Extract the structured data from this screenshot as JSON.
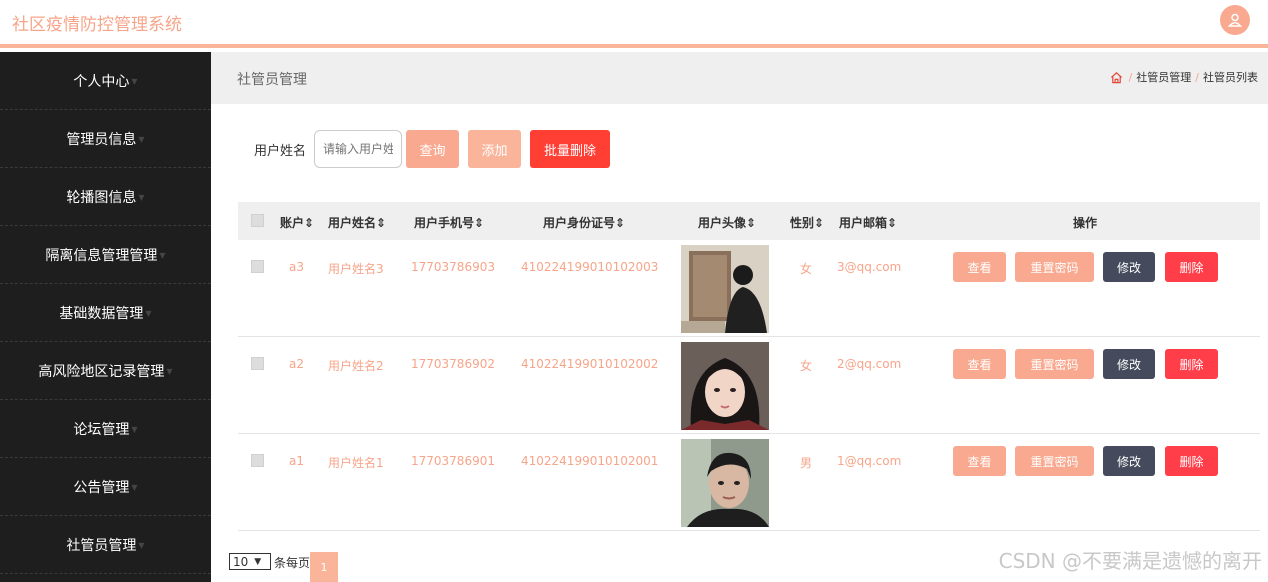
{
  "app_title": "社区疫情防控管理系统",
  "sidebar": {
    "items": [
      {
        "label": "个人中心"
      },
      {
        "label": "管理员信息"
      },
      {
        "label": "轮播图信息"
      },
      {
        "label": "隔离信息管理管理"
      },
      {
        "label": "基础数据管理"
      },
      {
        "label": "高风险地区记录管理"
      },
      {
        "label": "论坛管理"
      },
      {
        "label": "公告管理"
      },
      {
        "label": "社管员管理"
      }
    ]
  },
  "page_header": {
    "title": "社管员管理",
    "breadcrumb": [
      "社管员管理",
      "社管员列表"
    ]
  },
  "search": {
    "label": "用户姓名",
    "placeholder": "请输入用户姓",
    "query_label": "查询",
    "add_label": "添加",
    "batch_delete_label": "批量删除"
  },
  "table": {
    "headers": {
      "account": "账户",
      "name": "用户姓名",
      "phone": "用户手机号",
      "id_card": "用户身份证号",
      "avatar": "用户头像",
      "gender": "性别",
      "email": "用户邮箱",
      "actions": "操作"
    },
    "rows": [
      {
        "account": "a3",
        "name": "用户姓名3",
        "phone": "17703786903",
        "id_card": "410224199010102003",
        "gender": "女",
        "email": "3@qq.com"
      },
      {
        "account": "a2",
        "name": "用户姓名2",
        "phone": "17703786902",
        "id_card": "410224199010102002",
        "gender": "女",
        "email": "2@qq.com"
      },
      {
        "account": "a1",
        "name": "用户姓名1",
        "phone": "17703786901",
        "id_card": "410224199010102001",
        "gender": "男",
        "email": "1@qq.com"
      }
    ],
    "row_actions": {
      "view": "查看",
      "reset": "重置密码",
      "edit": "修改",
      "delete": "删除"
    }
  },
  "pagination": {
    "page_size": "10",
    "page_size_label": "条每页",
    "current_page": "1"
  },
  "watermark": "CSDN @不要满是遗憾的离开",
  "colors": {
    "accent": "#f9a98f",
    "sidebar_bg": "#1e1e1e",
    "danger": "#ff3e34",
    "edit": "#454b5c"
  }
}
